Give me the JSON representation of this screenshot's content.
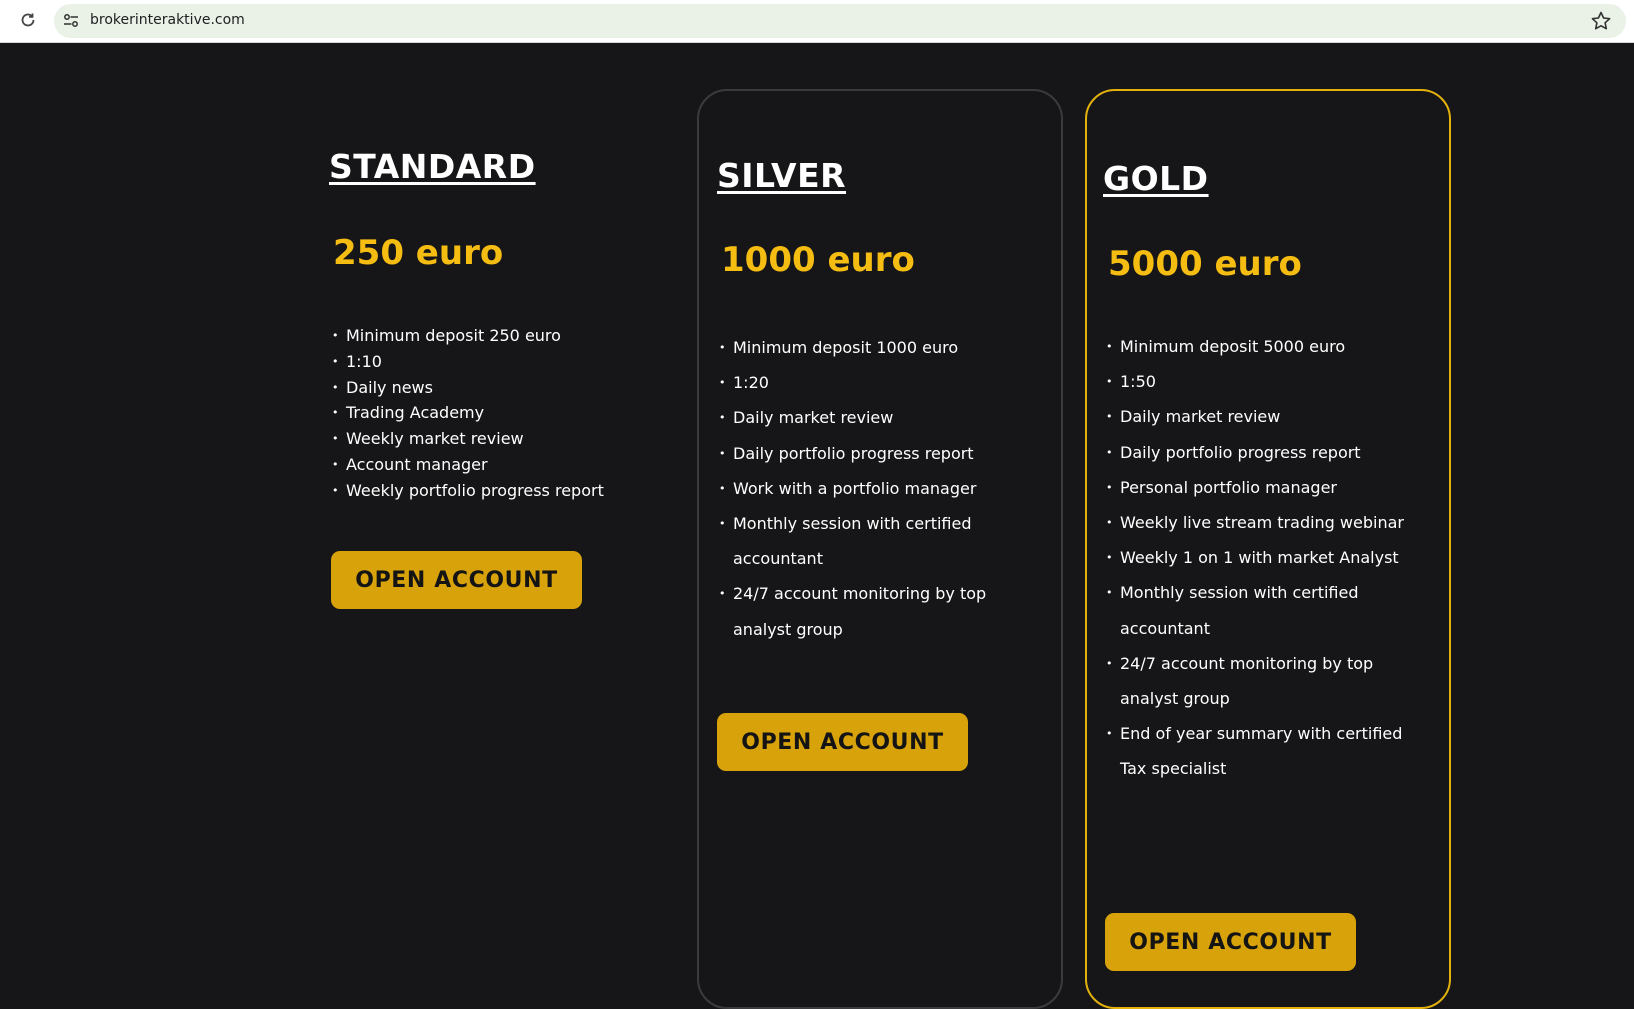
{
  "browser": {
    "url": "brokerinteraktive.com"
  },
  "plans": [
    {
      "name": "STANDARD",
      "price": "250 euro",
      "features": [
        "Minimum deposit 250 euro",
        "1:10",
        "Daily news",
        "Trading Academy",
        "Weekly market review",
        "Account manager",
        "Weekly portfolio progress report"
      ],
      "button": "OPEN ACCOUNT"
    },
    {
      "name": "SILVER",
      "price": "1000 euro",
      "features": [
        "Minimum deposit 1000 euro",
        "1:20",
        "Daily market review",
        "Daily portfolio progress report",
        "Work with a portfolio manager",
        "Monthly session with certified accountant",
        "24/7 account monitoring by top analyst group"
      ],
      "button": "OPEN ACCOUNT"
    },
    {
      "name": "GOLD",
      "price": "5000 euro",
      "features": [
        "Minimum deposit 5000 euro",
        "1:50",
        "Daily market review",
        "Daily portfolio progress report",
        "Personal portfolio manager",
        "Weekly live stream trading webinar",
        "Weekly 1 on 1 with market Analyst",
        "Monthly session with certified accountant",
        "24/7 account monitoring by top analyst group",
        "End of year summary with certified Tax specialist"
      ],
      "button": "OPEN ACCOUNT"
    }
  ],
  "colors": {
    "background": "#161618",
    "price": "#f5bd12",
    "button": "#d8a20a",
    "gold_border": "#e2b10c",
    "silver_border": "#3b3b3e"
  }
}
